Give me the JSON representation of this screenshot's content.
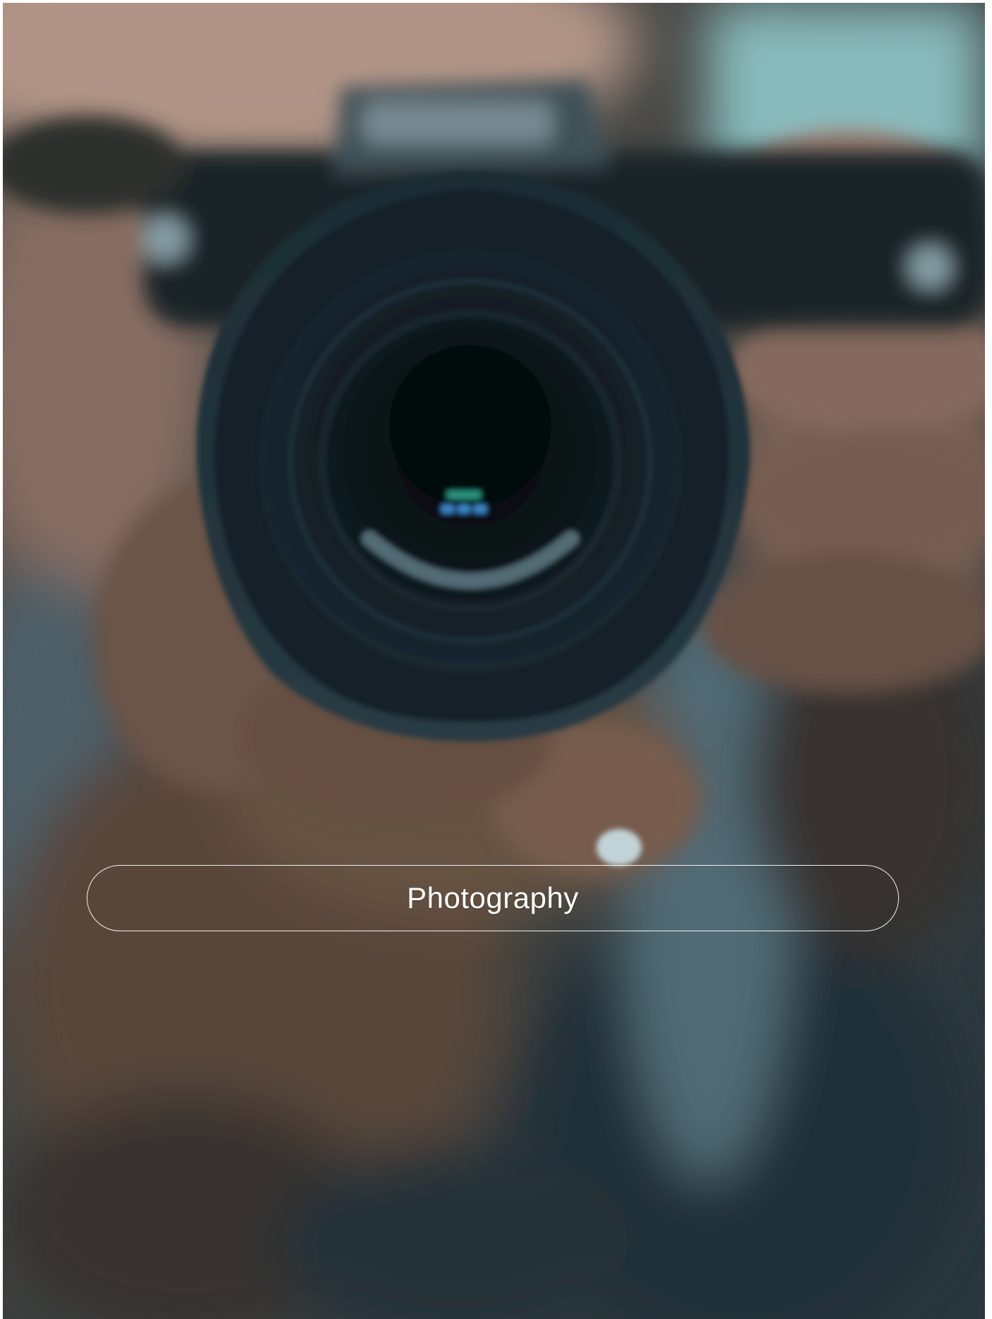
{
  "hero": {
    "image_icon": "photographer-with-camera-photo"
  },
  "category": {
    "label": "Photography"
  },
  "colors": {
    "overlay_text": "#ffffff",
    "button_border": "#ffffff"
  }
}
